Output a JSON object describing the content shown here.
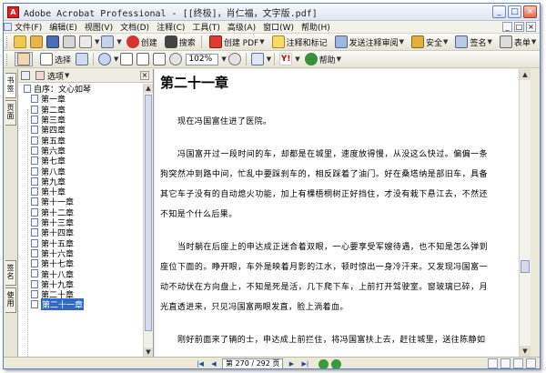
{
  "window": {
    "app_logo": "A",
    "title": "Adobe Acrobat Professional - [[终极]，肖仁福，文字版.pdf]",
    "buttons": {
      "minimize": "_",
      "maximize": "□",
      "close": "×"
    }
  },
  "menubar": {
    "items": [
      "文件(F)",
      "编辑(E)",
      "视图(V)",
      "文档(D)",
      "注释(C)",
      "工具(T)",
      "高级(A)",
      "窗口(W)",
      "帮助(H)"
    ],
    "right_controls": [
      "_",
      "□",
      "×"
    ]
  },
  "toolbar1": {
    "print_label": "创建",
    "search_label": "搜索",
    "create_pdf_label": "创建 PDF",
    "comment_label": "注释和标记",
    "send_label": "发送注释审阅",
    "secure_label": "安全",
    "sign_label": "签名",
    "forms_label": "表单"
  },
  "toolbar2": {
    "select_label": "选择",
    "zoom_value": "102%",
    "help_label": "帮助"
  },
  "left_tabs": [
    "书签",
    "页面",
    "签名",
    "使用"
  ],
  "nav_panel": {
    "options_label": "选项",
    "close": "×",
    "bookmarks": [
      "自序：文心如琴",
      "第一章",
      "第二章",
      "第三章",
      "第四章",
      "第五章",
      "第六章",
      "第七章",
      "第八章",
      "第九章",
      "第十章",
      "第十一章",
      "第十二章",
      "第十三章",
      "第十四章",
      "第十五章",
      "第十六章",
      "第十七章",
      "第十八章",
      "第十九章",
      "第二十章",
      "第二十一章"
    ],
    "selected_index": 21
  },
  "document": {
    "chapter_title": "第二十一章",
    "paragraphs": [
      "现在冯国富住进了医院。",
      "冯国富开过一段时间的车，却都是在城里，速度放得慢，从没这么快过。偏偏一条狗突然冲到路中间，忙乱中要踩刹车的，相反踩着了油门。好在桑塔纳是部旧车，具备其它车子没有的自动熄火功能，加上有棵梧桐树正好挡住，才没有栽下悬江去，不然还不知是个什么后果。",
      "当时躺在后座上的申达成正迷合着双眼，一心要享受军嫂待遇，也不知是怎么弹到座位下面的。睁开眼，车外是映着月影的江水，顿时惊出一身冷汗来。又发现冯国富一动不动伏在方向盘上，不知是死是活，几下爬下车，上前打开驾驶室。窗玻璃已碎，月光直透进来，只见冯国富两眼发直，脸上淌着血。",
      "刚好前面来了辆的士，申达成上前拦住，将冯国富扶上去，赶往城里，送往陈静如"
    ]
  },
  "statusbar": {
    "page_display": "第 270 / 292 页",
    "nav": [
      "|◀",
      "◀",
      "▶",
      "▶|"
    ]
  },
  "colors": {
    "selection": "#316ac5",
    "window_border": "#5a7fc0",
    "chrome": "#ece9d8"
  }
}
